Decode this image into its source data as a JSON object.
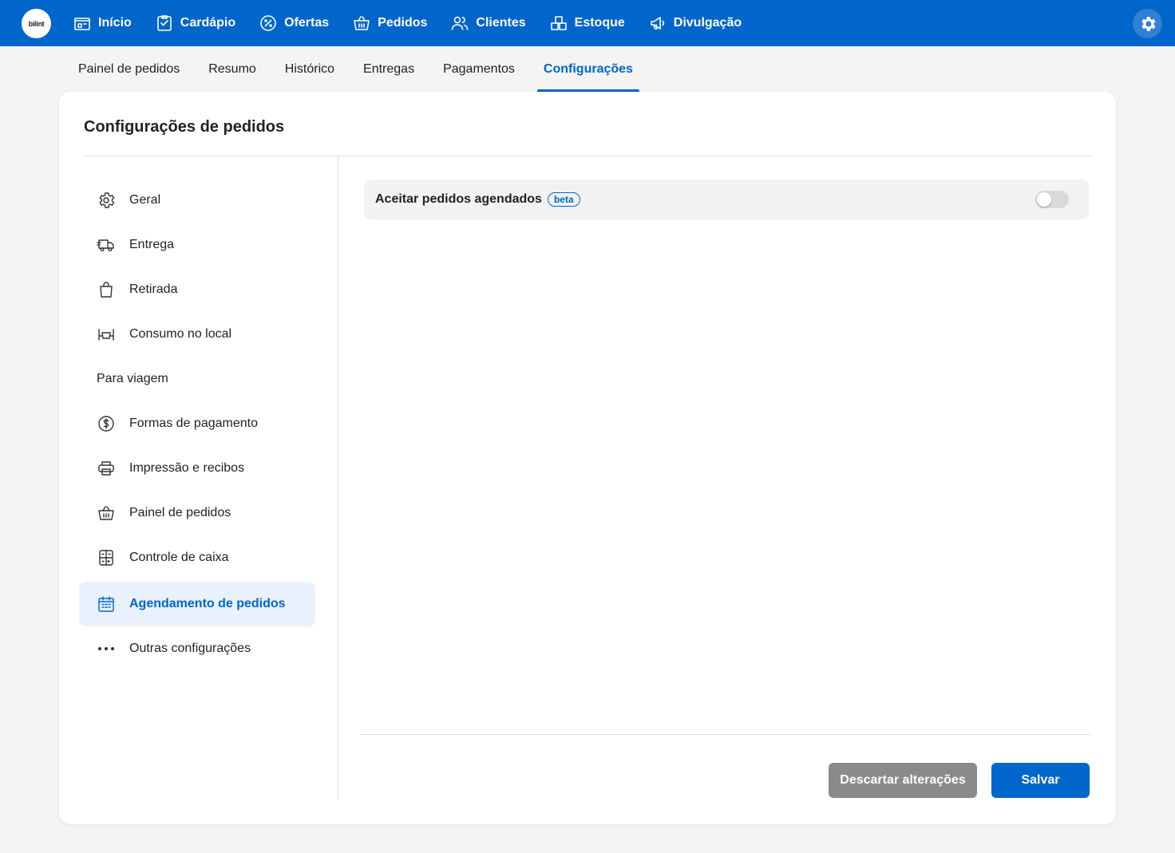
{
  "brand": {
    "logo_text": "bilint"
  },
  "topnav": [
    {
      "label": "Início",
      "icon": "store-icon"
    },
    {
      "label": "Cardápio",
      "icon": "menu-clipboard-icon"
    },
    {
      "label": "Ofertas",
      "icon": "discount-badge-icon"
    },
    {
      "label": "Pedidos",
      "icon": "basket-icon"
    },
    {
      "label": "Clientes",
      "icon": "users-icon"
    },
    {
      "label": "Estoque",
      "icon": "boxes-icon"
    },
    {
      "label": "Divulgação",
      "icon": "megaphone-icon"
    }
  ],
  "subtabs": [
    {
      "label": "Painel de pedidos",
      "active": false
    },
    {
      "label": "Resumo",
      "active": false
    },
    {
      "label": "Histórico",
      "active": false
    },
    {
      "label": "Entregas",
      "active": false
    },
    {
      "label": "Pagamentos",
      "active": false
    },
    {
      "label": "Configurações",
      "active": true
    }
  ],
  "page": {
    "title": "Configurações de pedidos"
  },
  "sidebar": {
    "items": [
      {
        "label": "Geral",
        "icon": "gear-icon"
      },
      {
        "label": "Entrega",
        "icon": "delivery-truck-icon"
      },
      {
        "label": "Retirada",
        "icon": "shopping-bag-icon"
      },
      {
        "label": "Consumo no local",
        "icon": "dining-table-icon"
      },
      {
        "label": "Para viagem",
        "icon": ""
      },
      {
        "label": "Formas de pagamento",
        "icon": "dollar-circle-icon"
      },
      {
        "label": "Impressão e recibos",
        "icon": "printer-icon"
      },
      {
        "label": "Painel de pedidos",
        "icon": "basket-icon"
      },
      {
        "label": "Controle de caixa",
        "icon": "calculator-icon"
      },
      {
        "label": "Agendamento de pedidos",
        "icon": "calendar-icon",
        "active": true
      },
      {
        "label": "Outras configurações",
        "icon": "more-dots-icon"
      }
    ]
  },
  "setting": {
    "label": "Aceitar pedidos agendados",
    "badge": "beta",
    "enabled": false
  },
  "actions": {
    "discard_label": "Descartar alterações",
    "save_label": "Salvar"
  },
  "colors": {
    "primary": "#0066cc",
    "discard": "#8a8a8a",
    "active_bg": "#e8f1fc"
  }
}
